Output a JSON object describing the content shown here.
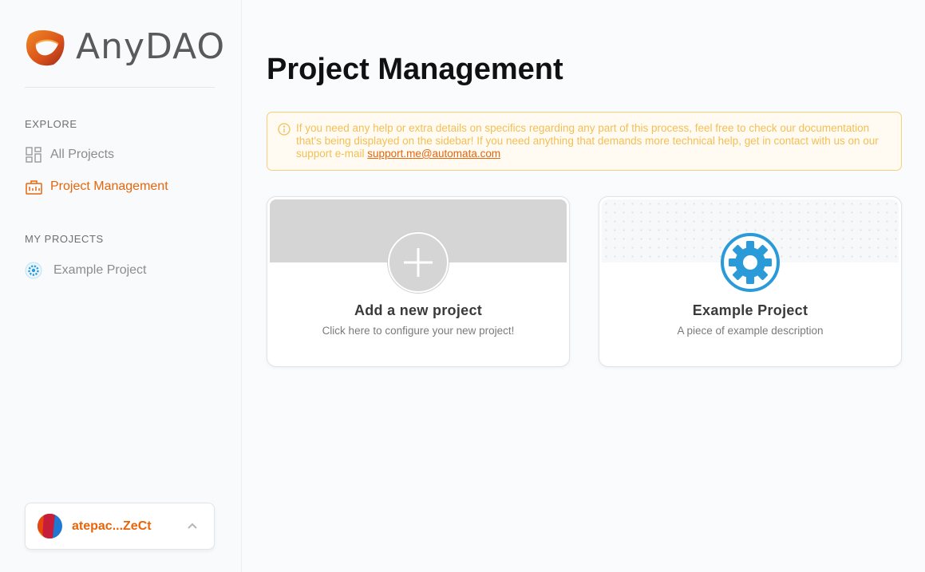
{
  "brand": {
    "name": "AnyDAO",
    "accent": "#e8650a"
  },
  "sidebar": {
    "explore_heading": "EXPLORE",
    "explore_items": [
      {
        "label": "All Projects",
        "icon": "grid-icon",
        "active": false
      },
      {
        "label": "Project Management",
        "icon": "briefcase-icon",
        "active": true
      }
    ],
    "my_projects_heading": "MY PROJECTS",
    "my_projects": [
      {
        "label": "Example Project",
        "icon": "gear-icon"
      }
    ],
    "user": {
      "name": "atepac...ZeCt",
      "icon": "chevron-up-icon"
    }
  },
  "main": {
    "title": "Project Management",
    "notice": {
      "text": "If you need any help or extra details on specifics regarding any part of this process, feel free to check our documentation that's being displayed on the sidebar! If you need anything that demands more technical help, get in contact with us on our support e-mail ",
      "link": "support.me@automata.com",
      "icon": "info-icon"
    },
    "cards": [
      {
        "title": "Add a new project",
        "description": "Click here to configure your new project!",
        "icon": "plus-icon"
      },
      {
        "title": "Example Project",
        "description": "A piece of example description",
        "icon": "gear-icon"
      }
    ]
  }
}
